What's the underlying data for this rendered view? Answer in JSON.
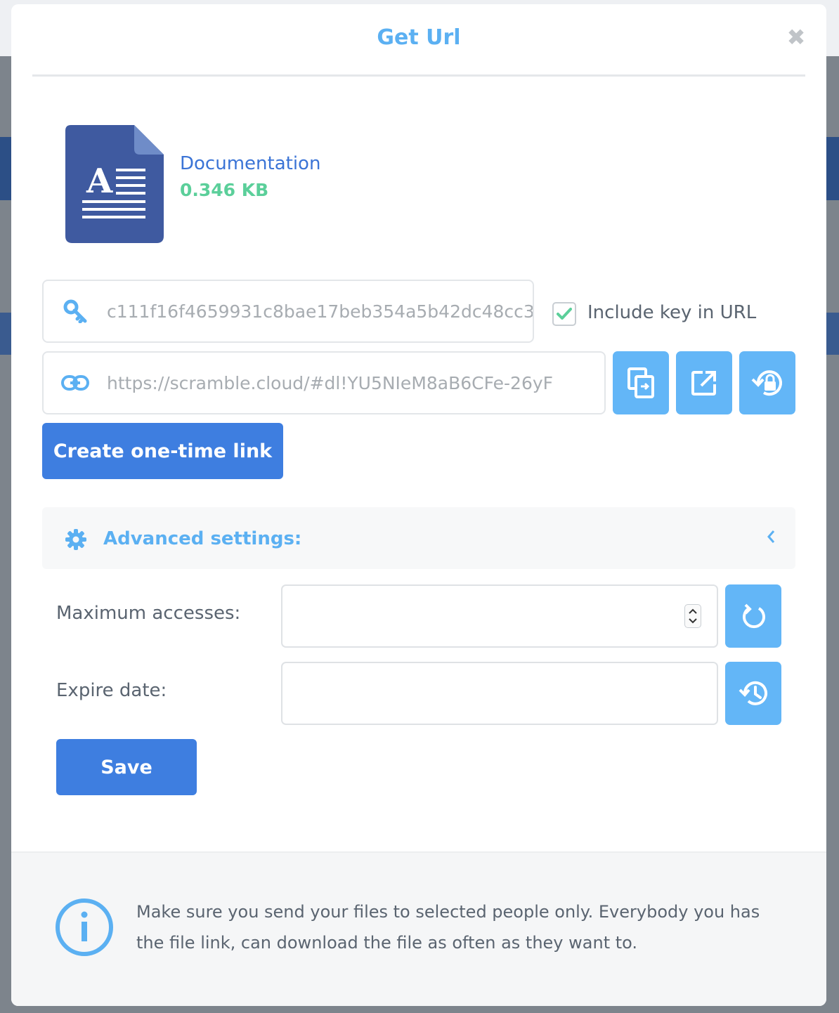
{
  "modal": {
    "title": "Get Url",
    "close_icon": "close-icon"
  },
  "file": {
    "name": "Documentation",
    "size": "0.346 KB",
    "icon": "document-icon"
  },
  "key": {
    "value": "c111f16f4659931c8bae17beb354a5b42dc48cc3",
    "icon": "key-icon"
  },
  "include_key": {
    "label": "Include key in URL",
    "checked": true
  },
  "url": {
    "value": "https://scramble.cloud/#dl!YU5NIeM8aB6CFe-26yF",
    "icon": "link-icon"
  },
  "url_actions": [
    {
      "name": "copy-icon"
    },
    {
      "name": "external-link-icon"
    },
    {
      "name": "regenerate-lock-icon"
    }
  ],
  "one_time_link": {
    "label": "Create one-time link"
  },
  "advanced": {
    "label": "Advanced settings:",
    "icon": "gear-icon",
    "chevron": "chevron-left-icon"
  },
  "settings": {
    "max_accesses_label": "Maximum accesses:",
    "max_accesses_value": "",
    "expire_date_label": "Expire date:",
    "expire_date_value": ""
  },
  "save": {
    "label": "Save"
  },
  "footer": {
    "text": "Make sure you send your files to selected people only. Everybody you has the file link, can download the file as often as they want to.",
    "icon": "info-icon"
  },
  "colors": {
    "accent": "#5bb0f2",
    "primary": "#3e7ee0",
    "icon_button": "#63b6f7",
    "success": "#5bcf9a",
    "doc_blue": "#3f5aa0"
  }
}
